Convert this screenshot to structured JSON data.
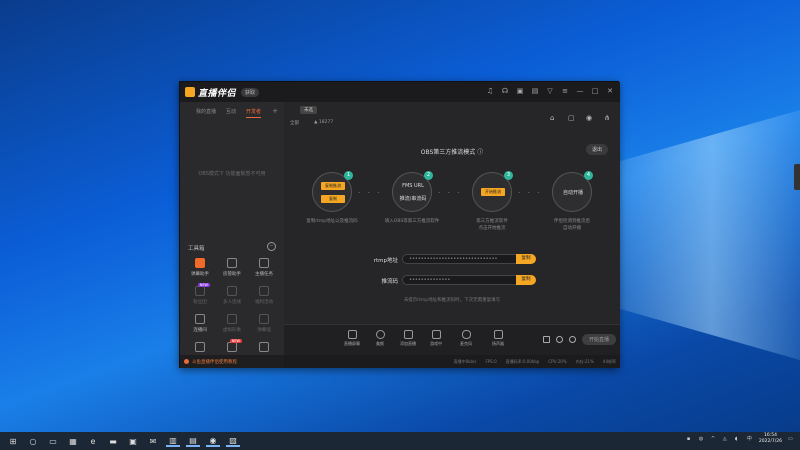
{
  "app": {
    "title": "直播伴侣",
    "version_label": "获取"
  },
  "sidebar": {
    "tabs": [
      "我的直播",
      "互动",
      "开发者"
    ],
    "empty_msg": "OBS模式下 功能面板暂不可用",
    "tools_heading": "工具箱",
    "tools": [
      {
        "label": "弹幕助手",
        "state": "active",
        "badge": ""
      },
      {
        "label": "房管助手",
        "state": "normal",
        "badge": ""
      },
      {
        "label": "主播任务",
        "state": "normal",
        "badge": ""
      },
      {
        "label": "粉丝团",
        "state": "dim",
        "badge": "NEW"
      },
      {
        "label": "多人连线",
        "state": "dim",
        "badge": ""
      },
      {
        "label": "福利活动",
        "state": "dim",
        "badge": ""
      },
      {
        "label": "连播间",
        "state": "normal",
        "badge": ""
      },
      {
        "label": "虚拟形象",
        "state": "dim",
        "badge": ""
      },
      {
        "label": "弹幕墙",
        "state": "dim",
        "badge": ""
      },
      {
        "label": "",
        "state": "normal",
        "badge": ""
      },
      {
        "label": "",
        "state": "normal",
        "badge": "NEW"
      },
      {
        "label": "",
        "state": "normal",
        "badge": ""
      }
    ],
    "footer_text": "斗鱼直播伴侣使用教程"
  },
  "main": {
    "game_tag": "未选",
    "category": "全部",
    "fans": "18277",
    "obs_title": "OBS第三方推流模式",
    "exit_label": "退出",
    "steps": [
      {
        "num": "1",
        "buttons": [
          "复制推流",
          "复制"
        ],
        "text": "",
        "caption": [
          "复制rtmp地址以及推流码"
        ]
      },
      {
        "num": "2",
        "buttons": [],
        "text": "FMS URL",
        "text2": "推流/串流码",
        "caption": [
          "填入OBS等第三方推流软件"
        ]
      },
      {
        "num": "3",
        "buttons": [
          "开始推流"
        ],
        "text": "",
        "caption": [
          "第三方推流软件",
          "点击开始推流"
        ]
      },
      {
        "num": "4",
        "buttons": [],
        "text": "自动开播",
        "caption": [
          "伴侣检测到推流后",
          "自动开播"
        ]
      }
    ],
    "rtmp_label": "rtmp地址",
    "rtmp_value": "••••••••••••••••••••••••••••••",
    "code_label": "推流码",
    "code_value": "••••••••••••••",
    "copy_label": "复制",
    "hint": "未提示rtmp地址和推流码时，下次无需重复填写"
  },
  "bottom_bar": {
    "items": [
      "直播屏幕",
      "美颜",
      "添加直播",
      "游戏中",
      "麦克风",
      "扬声器"
    ],
    "live_label": "开始直播"
  },
  "statusbar": [
    "直播中0kb/s",
    "FPS:0",
    "直播码率:0.00kbp",
    "CPU:20%",
    "内存:21%",
    "44帧率"
  ],
  "taskbar": {
    "time": "16:54",
    "date": "2022/7/26"
  }
}
